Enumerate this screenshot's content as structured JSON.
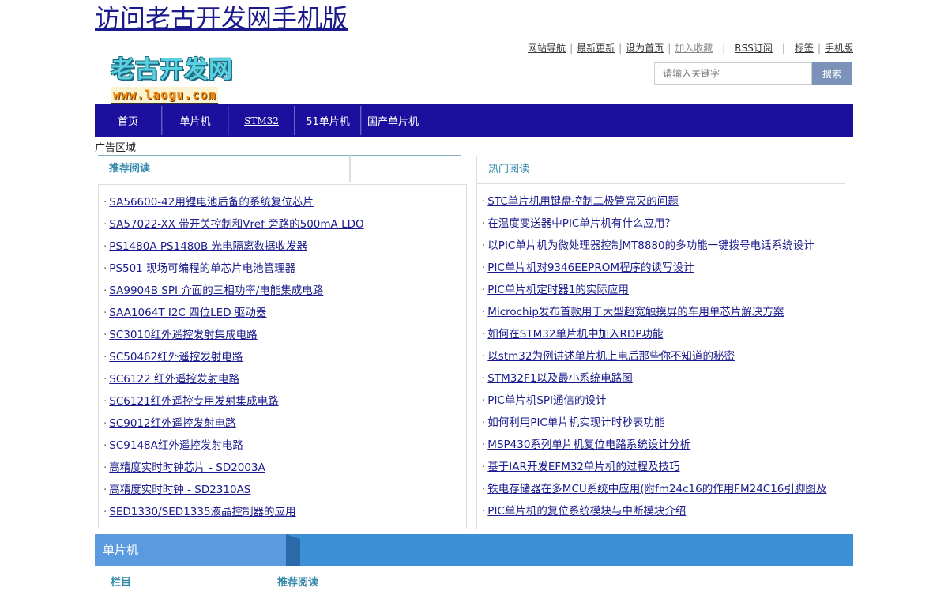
{
  "header": {
    "mobile_link": "访问老古开发网手机版",
    "toplinks": [
      {
        "label": "网站导航"
      },
      {
        "label": "最新更新"
      },
      {
        "label": "设为首页"
      },
      {
        "label": "加入收藏"
      },
      {
        "label": "RSS订阅"
      },
      {
        "label": "标签"
      },
      {
        "label": "手机版"
      }
    ],
    "logo": {
      "name": "老古开发网",
      "url_text": "www.laogu.com"
    },
    "search": {
      "placeholder": "请输入关键字",
      "button": "搜索"
    }
  },
  "nav": {
    "items": [
      {
        "label": "首页"
      },
      {
        "label": "单片机"
      },
      {
        "label": "STM32"
      },
      {
        "label": "51单片机"
      },
      {
        "label": "国产单片机"
      }
    ]
  },
  "ad_label": "广告区域",
  "recommended": {
    "title": "推荐阅读",
    "items": [
      "SA56600-42用锂电池后备的系统复位芯片",
      "SA57022-XX 带开关控制和Vref 旁路的500mA LDO",
      "PS1480A PS1480B 光电隔离数据收发器",
      "PS501 现场可编程的单芯片电池管理器",
      "SA9904B SPI 介面的三相功率/电能集成电路",
      "SAA1064T I2C 四位LED 驱动器",
      "SC3010红外遥控发射集成电路",
      "SC50462红外遥控发射电路",
      "SC6122 红外遥控发射电路",
      "SC6121红外遥控专用发射集成电路",
      "SC9012红外遥控发射电路",
      "SC9148A红外遥控发射电路",
      "高精度实时时钟芯片 - SD2003A",
      "高精度实时时钟 - SD2310AS",
      "SED1330/SED1335液晶控制器的应用"
    ]
  },
  "hot": {
    "title": "热门阅读",
    "items": [
      "STC单片机用键盘控制二极管亮灭的问题",
      "在温度变送器中PIC单片机有什么应用？",
      "以PIC单片机为微处理器控制MT8880的多功能一键拨号电话系统设计",
      "PIC单片机对9346EEPROM程序的读写设计",
      "PIC单片机定时器1的实际应用",
      "Microchip发布首款用于大型超宽触摸屏的车用单芯片解决方案",
      "如何在STM32单片机中加入RDP功能",
      "以stm32为例讲述单片机上电后那些你不知道的秘密",
      "STM32F1以及最小系统电路图",
      "PIC单片机SPI通信的设计",
      "如何利用PIC单片机实现计时秒表功能",
      "MSP430系列单片机复位电路系统设计分析",
      "基于IAR开发EFM32单片机的过程及技巧",
      "铁电存储器在多MCU系统中应用(附fm24c16的作用FM24C16引脚图及",
      "PIC单片机的复位系统模块与中断模块介绍"
    ]
  },
  "section": {
    "title": "单片机",
    "tabs": [
      "栏目",
      "推荐阅读"
    ]
  }
}
